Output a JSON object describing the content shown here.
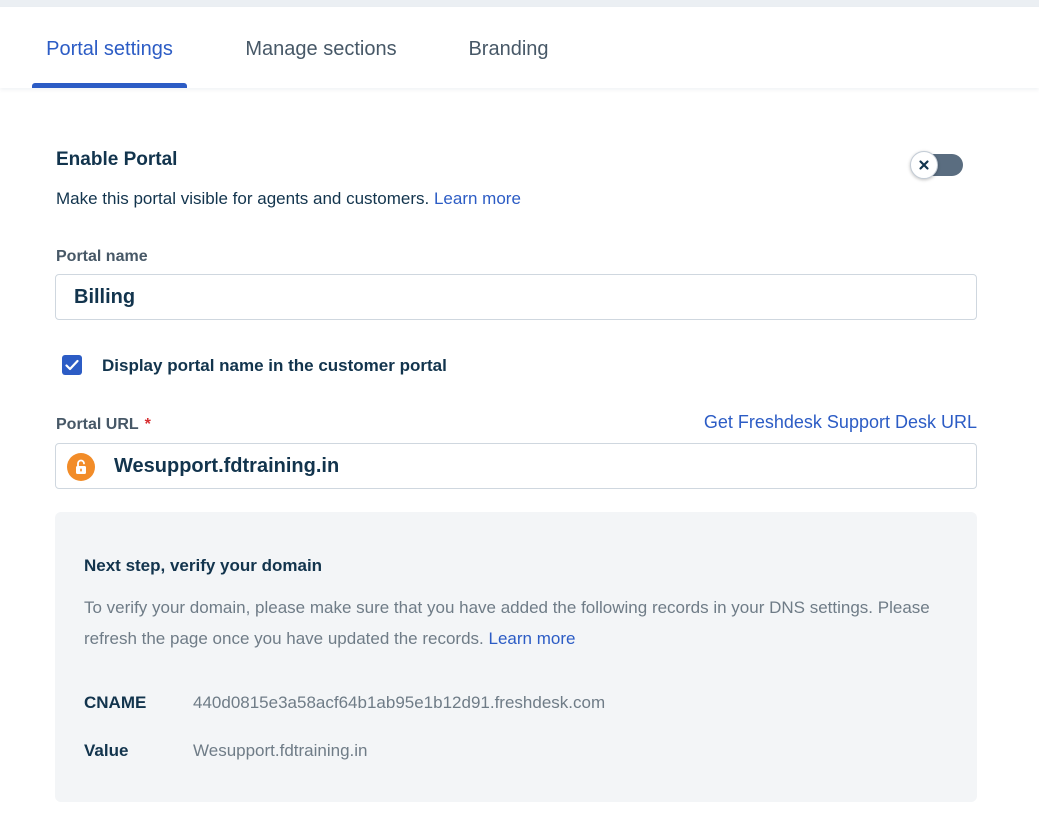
{
  "tabs": [
    {
      "label": "Portal settings",
      "active": true
    },
    {
      "label": "Manage sections",
      "active": false
    },
    {
      "label": "Branding",
      "active": false
    }
  ],
  "enable_portal": {
    "title": "Enable Portal",
    "description": "Make this portal visible for agents and customers.",
    "learn_more": "Learn more",
    "enabled": false,
    "toggle_icon": "close-icon"
  },
  "portal_name": {
    "label": "Portal name",
    "value": "Billing"
  },
  "display_name_checkbox": {
    "label": "Display portal name in the customer portal",
    "checked": true
  },
  "portal_url": {
    "label": "Portal URL",
    "required_mark": "*",
    "get_url_link": "Get Freshdesk Support Desk URL",
    "value": "Wesupport.fdtraining.in",
    "lock_icon": "unlock-icon"
  },
  "verify_domain": {
    "title": "Next step, verify your domain",
    "description": "To verify your domain, please make sure that you have added the following records in your DNS settings. Please refresh the page once you have updated the records.",
    "learn_more": "Learn more",
    "records": [
      {
        "key": "CNAME",
        "value": "440d0815e3a58acf64b1ab95e1b12d91.freshdesk.com"
      },
      {
        "key": "Value",
        "value": "Wesupport.fdtraining.in"
      }
    ]
  },
  "colors": {
    "accent": "#2c5cc5",
    "toggle_off": "#5a6d80",
    "lock_badge": "#f28c28",
    "panel_bg": "#f3f5f7"
  }
}
